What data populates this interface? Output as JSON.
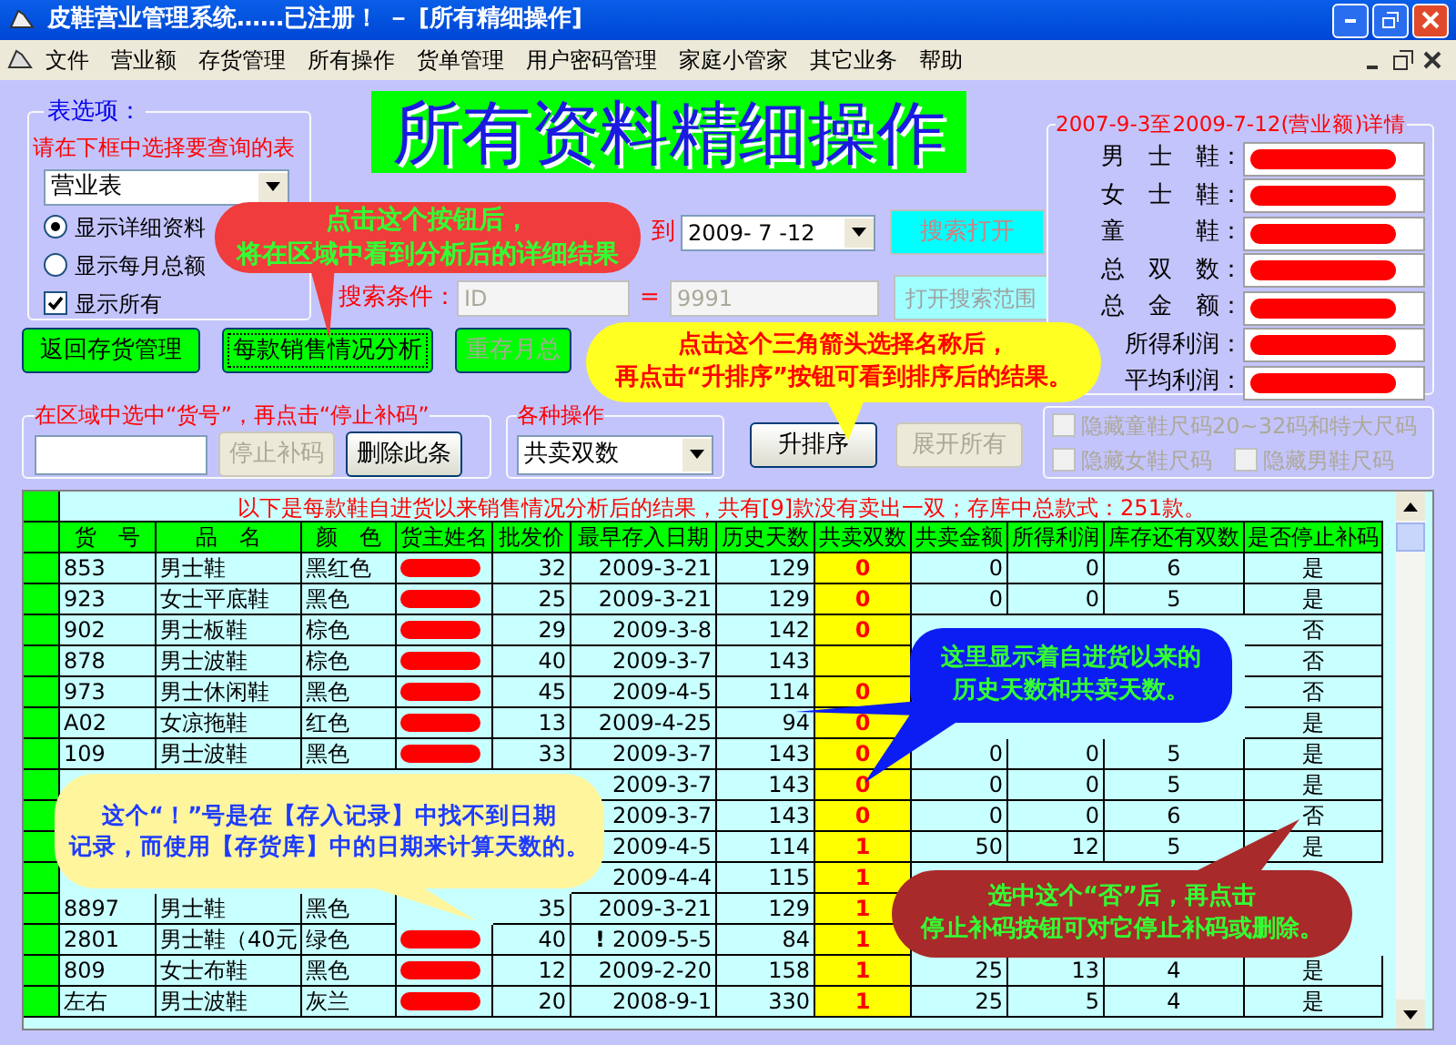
{
  "window": {
    "title": "皮鞋营业管理系统……已注册！ － [所有精细操作]"
  },
  "menu": [
    "文件",
    "营业额",
    "存货管理",
    "所有操作",
    "货单管理",
    "用户密码管理",
    "家庭小管家",
    "其它业务",
    "帮助"
  ],
  "table_options": {
    "title": "表选项：",
    "hint": "请在下框中选择要查询的表",
    "table_select": "营业表",
    "options": [
      {
        "kind": "radio",
        "label": "显示详细资料",
        "selected": true
      },
      {
        "kind": "radio",
        "label": "显示每月总额",
        "selected": false
      },
      {
        "kind": "checkbox",
        "label": "显示所有",
        "checked": true
      }
    ]
  },
  "banner": "所有资料精细操作",
  "date_range": {
    "separator": "到",
    "date_to": "2009- 7 -12"
  },
  "search": {
    "label": "搜索条件：",
    "field": "ID",
    "operator": "=",
    "value": "9991"
  },
  "search_buttons": [
    {
      "label": "搜索打开",
      "disabled": true
    },
    {
      "label": "打开搜索范围",
      "disabled": true
    }
  ],
  "summary": {
    "title": "2007-9-3至2009-7-12(营业额)详情",
    "rows": [
      {
        "label": "男　士　鞋：",
        "redacted": true
      },
      {
        "label": "女　士　鞋：",
        "redacted": true
      },
      {
        "label": "童　　　鞋：",
        "redacted": true
      },
      {
        "label": "总　双　数：",
        "redacted": true
      },
      {
        "label": "总　金　额：",
        "redacted": true
      },
      {
        "label": "所得利润：",
        "redacted": true
      },
      {
        "label": "平均利润：",
        "redacted": true
      }
    ]
  },
  "action_buttons": [
    {
      "label": "返回存货管理",
      "disabled": false,
      "focused": false
    },
    {
      "label": "每款销售情况分析",
      "disabled": false,
      "focused": true
    },
    {
      "label": "重存月总",
      "disabled": true,
      "focused": false
    }
  ],
  "stop_group": {
    "title": "在区域中选中“货号”，再点击“停止补码”",
    "buttons": [
      {
        "label": "停止补码",
        "disabled": true
      },
      {
        "label": "删除此条",
        "disabled": false
      }
    ]
  },
  "operations": {
    "title": "各种操作",
    "select": "共卖双数",
    "buttons": [
      {
        "label": "升排序",
        "disabled": false
      },
      {
        "label": "展开所有",
        "disabled": true
      }
    ]
  },
  "hide_options": [
    {
      "label": "隐藏童鞋尺码20~32码和特大尺码",
      "checked": false,
      "disabled": true
    },
    {
      "label": "隐藏女鞋尺码",
      "checked": false,
      "disabled": true
    },
    {
      "label": "隐藏男鞋尺码",
      "checked": false,
      "disabled": true
    }
  ],
  "table": {
    "caption": "以下是每款鞋自进货以来销售情况分析后的结果，共有[9]款没有卖出一双；存库中总款式：251款。",
    "columns": [
      "货　号",
      "品　名",
      "颜　色",
      "货主姓名",
      "批发价",
      "最早存入日期",
      "历史天数",
      "共卖双数",
      "共卖金额",
      "所得利润",
      "库存还有双数",
      "是否停止补码"
    ],
    "rows": [
      {
        "cells": [
          "853",
          "男士鞋",
          "黑红色",
          null,
          "32",
          "2009-3-21",
          "129",
          "0",
          "0",
          "0",
          "6",
          "是"
        ],
        "owner_redacted": true
      },
      {
        "cells": [
          "923",
          "女士平底鞋",
          "黑色",
          null,
          "25",
          "2009-3-21",
          "129",
          "0",
          "0",
          "0",
          "5",
          "是"
        ],
        "owner_redacted": true
      },
      {
        "cells": [
          "902",
          "男士板鞋",
          "棕色",
          null,
          "29",
          "2009-3-8",
          "142",
          "0",
          null,
          null,
          null,
          "否"
        ],
        "owner_redacted": true
      },
      {
        "cells": [
          "878",
          "男士波鞋",
          "棕色",
          null,
          "40",
          "2009-3-7",
          "143",
          null,
          null,
          null,
          null,
          "否"
        ],
        "owner_redacted": true
      },
      {
        "cells": [
          "973",
          "男士休闲鞋",
          "黑色",
          null,
          "45",
          "2009-4-5",
          "114",
          "0",
          null,
          null,
          null,
          "否"
        ],
        "owner_redacted": true
      },
      {
        "cells": [
          "A02",
          "女凉拖鞋",
          "红色",
          null,
          "13",
          "2009-4-25",
          "94",
          "0",
          null,
          null,
          null,
          "是"
        ],
        "owner_redacted": true
      },
      {
        "cells": [
          "109",
          "男士波鞋",
          "黑色",
          null,
          "33",
          "2009-3-7",
          "143",
          "0",
          "0",
          "0",
          "5",
          "是"
        ],
        "owner_redacted": true
      },
      {
        "cells": [
          null,
          null,
          null,
          null,
          null,
          "2009-3-7",
          "143",
          "0",
          "0",
          "0",
          "5",
          "是"
        ],
        "owner_redacted": false
      },
      {
        "cells": [
          null,
          null,
          null,
          null,
          null,
          "2009-3-7",
          "143",
          "0",
          "0",
          "0",
          "6",
          "否"
        ],
        "owner_redacted": false
      },
      {
        "cells": [
          null,
          null,
          null,
          null,
          null,
          "2009-4-5",
          "114",
          "1",
          "50",
          "12",
          "5",
          "是"
        ],
        "owner_redacted": false
      },
      {
        "cells": [
          null,
          null,
          null,
          null,
          null,
          "2009-4-4",
          "115",
          "1",
          null,
          null,
          null,
          null
        ],
        "owner_redacted": false
      },
      {
        "cells": [
          "8897",
          "男士鞋",
          "黑色",
          null,
          "35",
          "2009-3-21",
          "129",
          "1",
          null,
          null,
          null,
          null
        ],
        "owner_redacted": false
      },
      {
        "cells": [
          "2801",
          "男士鞋（40元",
          "绿色",
          null,
          "40",
          "2009-5-5",
          "84",
          "1",
          null,
          null,
          null,
          null
        ],
        "owner_redacted": true,
        "date_flag": "!"
      },
      {
        "cells": [
          "809",
          "女士布鞋",
          "黑色",
          null,
          "12",
          "2009-2-20",
          "158",
          "1",
          "25",
          "13",
          "4",
          "是"
        ],
        "owner_redacted": true
      },
      {
        "cells": [
          "左右",
          "男士波鞋",
          "灰兰",
          null,
          "20",
          "2008-9-1",
          "330",
          "1",
          "25",
          "5",
          "4",
          "是"
        ],
        "owner_redacted": true
      }
    ]
  },
  "callouts": [
    {
      "lines": [
        "点击这个按钮后，",
        "将在区域中看到分析后的详细结果"
      ]
    },
    {
      "lines": [
        "点击这个三角箭头选择名称后，",
        "再点击“升排序”按钮可看到排序后的结果。"
      ]
    },
    {
      "lines": [
        "这里显示着自进货以来的",
        "历史天数和共卖天数。"
      ]
    },
    {
      "lines": [
        "这个“！”号是在【存入记录】中找不到日期",
        "记录，而使用【存货库】中的日期来计算天数的。"
      ]
    },
    {
      "lines": [
        "选中这个“否”后，再点击",
        "停止补码按钮可对它停止补码或删除。"
      ]
    }
  ]
}
